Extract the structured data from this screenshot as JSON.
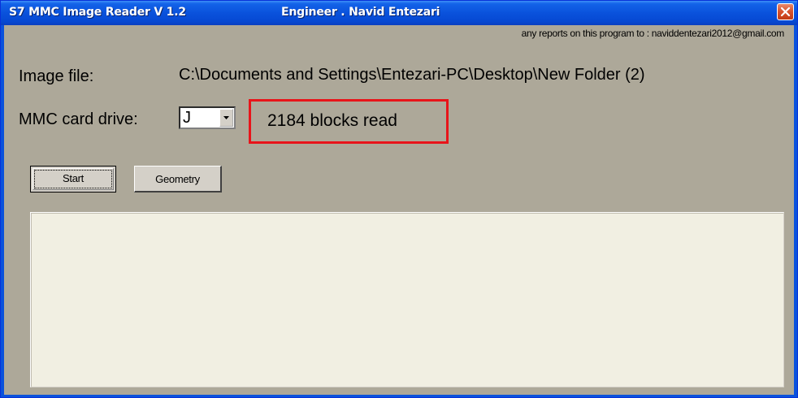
{
  "window": {
    "title": "S7 MMC Image Reader V 1.2",
    "engineer": "Engineer . Navid Entezari"
  },
  "reports_text": "any reports on this program to : naviddentezari2012@gmail.com",
  "image_file": {
    "label": "Image file:",
    "path": "C:\\Documents and Settings\\Entezari-PC\\Desktop\\New Folder (2)"
  },
  "drive": {
    "label": "MMC card drive:",
    "selected": "J"
  },
  "status": {
    "text": "2184 blocks read",
    "highlight_color": "#e8141a"
  },
  "buttons": {
    "start": "Start",
    "geometry": "Geometry"
  },
  "output_text": "",
  "icons": {
    "close": "close-icon",
    "dropdown": "chevron-down-icon"
  },
  "colors": {
    "titlebar": "#0a52dc",
    "window_bg": "#ada899",
    "close_button": "#d9542f",
    "output_bg": "#f1efe2"
  }
}
